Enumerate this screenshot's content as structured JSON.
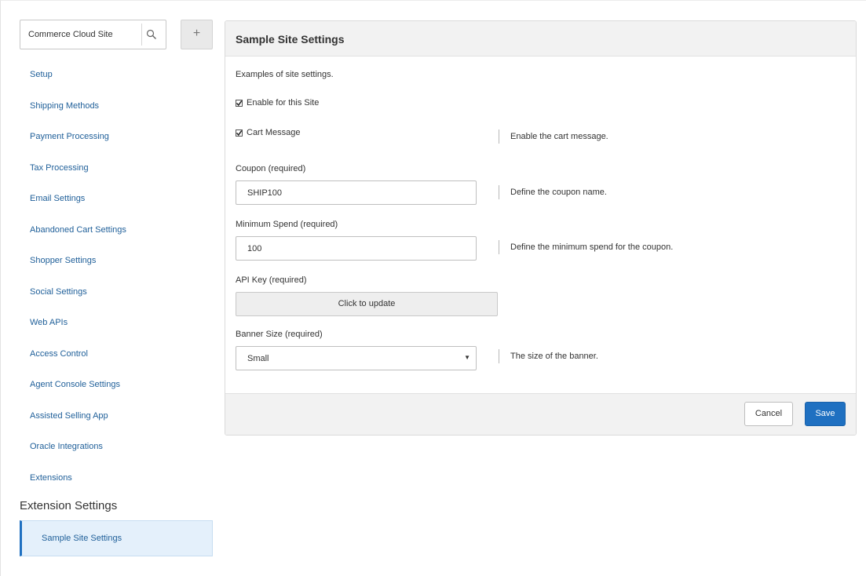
{
  "sidebar": {
    "site_select": {
      "value": "Commerce Cloud Site",
      "search_icon": "search-icon"
    },
    "add_label": "+",
    "items": [
      {
        "label": "Setup"
      },
      {
        "label": "Shipping Methods"
      },
      {
        "label": "Payment Processing"
      },
      {
        "label": "Tax Processing"
      },
      {
        "label": "Email Settings"
      },
      {
        "label": "Abandoned Cart Settings"
      },
      {
        "label": "Shopper Settings"
      },
      {
        "label": "Social Settings"
      },
      {
        "label": "Web APIs"
      },
      {
        "label": "Access Control"
      },
      {
        "label": "Agent Console Settings"
      },
      {
        "label": "Assisted Selling App"
      },
      {
        "label": "Oracle Integrations"
      },
      {
        "label": "Extensions"
      }
    ],
    "extension_heading": "Extension Settings",
    "extension_items": [
      {
        "label": "Sample Site Settings",
        "selected": true
      }
    ]
  },
  "panel": {
    "title": "Sample Site Settings",
    "intro": "Examples of site settings.",
    "enable_site": {
      "label": "Enable for this Site",
      "checked": true
    },
    "cart_message": {
      "label": "Cart Message",
      "checked": true,
      "help": "Enable the cart message."
    },
    "coupon": {
      "label": "Coupon (required)",
      "value": "SHIP100",
      "help": "Define the coupon name."
    },
    "minimum_spend": {
      "label": "Minimum Spend (required)",
      "value": "100",
      "help": "Define the minimum spend for the coupon."
    },
    "api_key": {
      "label": "API Key (required)",
      "button_label": "Click to update"
    },
    "banner_size": {
      "label": "Banner Size (required)",
      "selected": "Small",
      "help": "The size of the banner.",
      "caret": "▼"
    },
    "footer": {
      "cancel_label": "Cancel",
      "save_label": "Save"
    }
  },
  "colors": {
    "link": "#1f5f99",
    "accent": "#1f70c1",
    "selected_bg": "#e4f0fb",
    "panel_bar": "#f2f2f2"
  }
}
